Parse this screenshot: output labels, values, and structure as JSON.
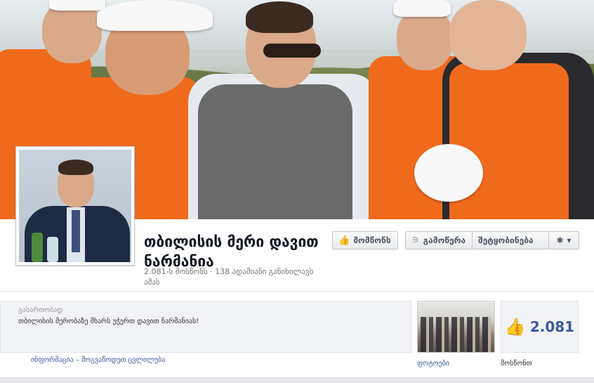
{
  "cover": {
    "alt": "cover-photo"
  },
  "page": {
    "name": "თბილისის მერი დავით ნარმანია",
    "stats": "2.081-ს მოსწონს · 138 ადამიანი განიხილავს ამას"
  },
  "actions": {
    "like_label": "მომწონს",
    "subscribe_label": "გამოწერა",
    "message_label": "შეტყობინება",
    "more_label": "▾"
  },
  "about": {
    "label": "გასართობად",
    "text": "თბილისის მერობაზე მხარს უჭერთ დავით ნარმანიას!",
    "info_link": "ინფორმაცია – მოგვაწოდეთ ცვლილება"
  },
  "photos": {
    "label": "ფოტოები"
  },
  "likes": {
    "count": "2.081",
    "label": "მოსწონთ"
  },
  "colors": {
    "accent": "#3b5998",
    "vest": "#f06a1c"
  },
  "icons": {
    "like": "thumbs-up-icon",
    "subscribe": "rss-icon",
    "more": "gear-icon"
  }
}
